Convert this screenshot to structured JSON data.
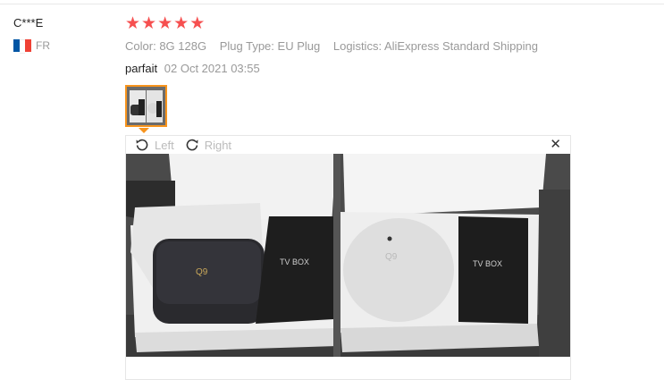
{
  "review": {
    "user_name": "C***E",
    "country_code": "FR",
    "flag_colors": [
      "#0055A4",
      "#FFFFFF",
      "#EF4135"
    ],
    "rating": 5,
    "star_color": "#f65050",
    "attributes": [
      {
        "key": "Color:",
        "value": "8G 128G"
      },
      {
        "key": "Plug Type:",
        "value": "EU Plug"
      },
      {
        "key": "Logistics:",
        "value": "AliExpress Standard Shipping"
      }
    ],
    "text": "parfait",
    "date": "02 Oct 2021 03:55"
  },
  "viewer": {
    "rotate_left_label": "Left",
    "rotate_right_label": "Right",
    "close_symbol": "✕",
    "accent_color": "#f7941d",
    "left_box_label": "TV BOX",
    "right_box_label": "TV BOX"
  }
}
